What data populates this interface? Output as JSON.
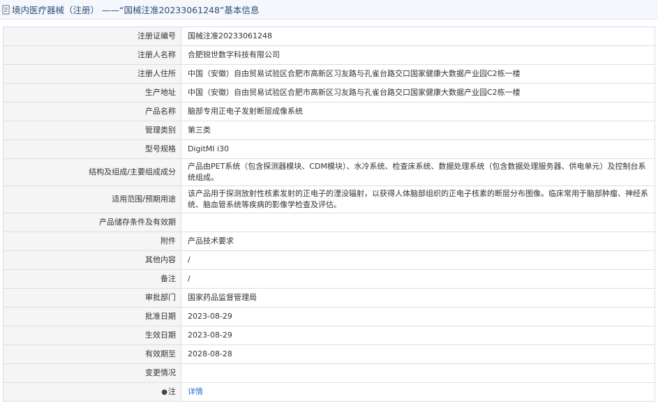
{
  "title": {
    "text": "境内医疗器械（注册） ——“国械注准20233061248”基本信息",
    "icon": "document-icon"
  },
  "rows": [
    {
      "label": "注册证编号",
      "value": "国械注准20233061248"
    },
    {
      "label": "注册人名称",
      "value": "合肥锐世数字科技有限公司"
    },
    {
      "label": "注册人住所",
      "value": "中国（安徽）自由贸易试验区合肥市高新区习友路与孔雀台路交口国家健康大数据产业园C2栋一楼"
    },
    {
      "label": "生产地址",
      "value": "中国（安徽）自由贸易试验区合肥市高新区习友路与孔雀台路交口国家健康大数据产业园C2栋一楼"
    },
    {
      "label": "产品名称",
      "value": "脑部专用正电子发射断层成像系统"
    },
    {
      "label": "管理类别",
      "value": "第三类"
    },
    {
      "label": "型号规格",
      "value": "DigitMI i30"
    },
    {
      "label": "结构及组成/主要组成成分",
      "value": "产品由PET系统（包含探测器模块、CDM模块）、水冷系统、检查床系统、数据处理系统（包含数据处理服务器、供电单元）及控制台系统组成。"
    },
    {
      "label": "适用范围/预期用途",
      "value": "该产品用于探测放射性核素发射的正电子的湮没辐射，以获得人体脑部组织的正电子核素的断层分布图像。临床常用于脑部肿瘤、神经系统、脑血管系统等疾病的影像学检查及评估。"
    },
    {
      "label": "产品储存条件及有效期",
      "value": ""
    },
    {
      "label": "附件",
      "value": "产品技术要求"
    },
    {
      "label": "其他内容",
      "value": "/"
    },
    {
      "label": "备注",
      "value": "/"
    },
    {
      "label": "审批部门",
      "value": "国家药品监督管理局"
    },
    {
      "label": "批准日期",
      "value": "2023-08-29"
    },
    {
      "label": "生效日期",
      "value": "2023-08-29"
    },
    {
      "label": "有效期至",
      "value": "2028-08-28"
    },
    {
      "label": "变更情况",
      "value": ""
    }
  ],
  "note_row": {
    "icon": "pin-icon",
    "icon_glyph": "●",
    "label": "注",
    "link_text": "详情"
  },
  "colors": {
    "title_text": "#2e4f7a",
    "label_bg": "#f5f5f5",
    "border": "#d9dee6",
    "link": "#2a6ad2"
  }
}
